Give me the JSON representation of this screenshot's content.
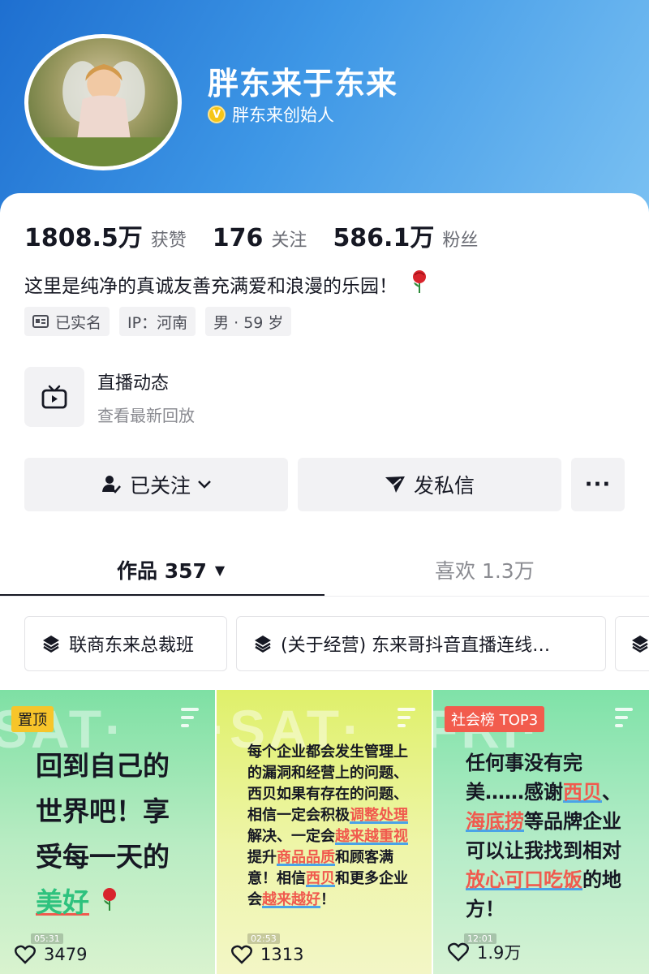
{
  "profile": {
    "nickname": "胖东来于东来",
    "verify_text": "胖东来创始人",
    "verify_badge": "V",
    "bio": "这里是纯净的真诚友善充满爱和浪漫的乐园！",
    "bio_emoji": "rose-icon",
    "colors": {
      "header_start": "#1e6fd0",
      "header_end": "#79c0f2",
      "verify": "#f5c518"
    }
  },
  "stats": [
    {
      "value": "1808.5万",
      "label": "获赞"
    },
    {
      "value": "176",
      "label": "关注"
    },
    {
      "value": "586.1万",
      "label": "粉丝"
    }
  ],
  "tags": [
    {
      "icon": "id-card-icon",
      "label": "已实名"
    },
    {
      "label": "IP：河南"
    },
    {
      "label": "男 · 59 岁"
    }
  ],
  "live": {
    "icon": "tv-icon",
    "title": "直播动态",
    "subtitle": "查看最新回放"
  },
  "actions": {
    "follow": "已关注",
    "message": "发私信",
    "more": "···"
  },
  "tabs": {
    "works_label": "作品 357",
    "works_caret": "▼",
    "likes_label": "喜欢 1.3万"
  },
  "collections": [
    {
      "icon": "layers-icon",
      "label": "联商东来总裁班"
    },
    {
      "icon": "layers-icon",
      "label": "(关于经营) 东来哥抖音直播连线…"
    },
    {
      "icon": "layers-icon",
      "label": ""
    }
  ],
  "videos": [
    {
      "badge": "置顶",
      "watermark": "SAT·",
      "text_lines": [
        "回到自己的",
        "世界吧！享",
        "受每一天的"
      ],
      "text_highlight": "美好",
      "duration": "05:31",
      "likes": "3479"
    },
    {
      "watermark": "·SAT·",
      "text_plain_1": "每个企业都会发生管理上的漏洞和经营上的问题、西贝如果有存在的问题、相信一定会积极",
      "text_hl_1": "调整处理",
      "text_plain_2": "解决、一定会",
      "text_hl_2": "越来越重视",
      "text_plain_3": "提升",
      "text_hl_3": "商品品质",
      "text_plain_4": "和顾客满意！相信",
      "text_hl_4": "西贝",
      "text_plain_5": "和更多企业会",
      "text_hl_5": "越来越好",
      "text_plain_6": "！",
      "duration": "02:53",
      "likes": "1313"
    },
    {
      "badge": "社会榜 TOP3",
      "watermark": "FRI·",
      "text_plain_1": "任何事没有完美……感谢",
      "text_hl_1": "西贝",
      "text_plain_2": "、",
      "text_hl_2": "海底捞",
      "text_plain_3": "等品牌企业可以让我找到相对",
      "text_hl_3": "放心可口吃饭",
      "text_plain_4": "的地方！",
      "duration": "12:01",
      "likes": "1.9万"
    }
  ]
}
